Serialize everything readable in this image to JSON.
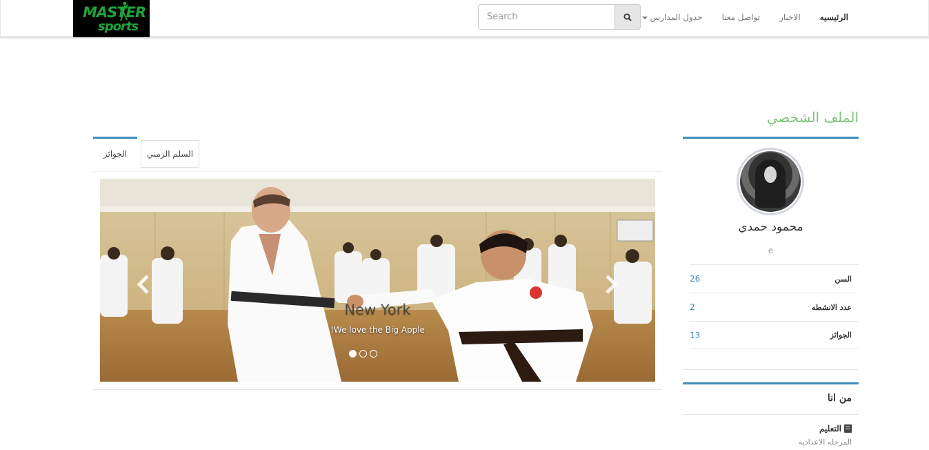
{
  "brand": {
    "line1": "MASTER",
    "line2": "sports"
  },
  "search": {
    "placeholder": "Search"
  },
  "nav": {
    "items": [
      {
        "label": "الرئيسيه",
        "active": true
      },
      {
        "label": "الاخبار",
        "active": false
      },
      {
        "label": "تواصل معنا",
        "active": false
      },
      {
        "label": "جدول المدارس",
        "active": false,
        "dropdown": true
      }
    ]
  },
  "page": {
    "title": "الملف الشخصي"
  },
  "profile": {
    "name": "محمود حمدي",
    "subtitle": "e",
    "stats": [
      {
        "label": "السن",
        "value": "26"
      },
      {
        "label": "عدد الانشطه",
        "value": "2"
      },
      {
        "label": "الجوائز",
        "value": "13"
      }
    ]
  },
  "about": {
    "title": "من انا",
    "education_label": "التعليم",
    "education_value": "المرحله الاعداديه"
  },
  "tabs": [
    {
      "label": "الجوائز",
      "active": true
    },
    {
      "label": "السلم الزمني",
      "active": false
    }
  ],
  "carousel": {
    "title": "New York",
    "text": "!We love the Big Apple",
    "slide_count": 3,
    "active_slide": 1
  },
  "colors": {
    "accent": "#3c8dbc",
    "title_green": "#7cc576",
    "brand_green": "#1fa33a"
  },
  "icons": [
    "search-icon",
    "caret-down-icon",
    "book-icon",
    "chevron-left-icon",
    "chevron-right-icon"
  ]
}
